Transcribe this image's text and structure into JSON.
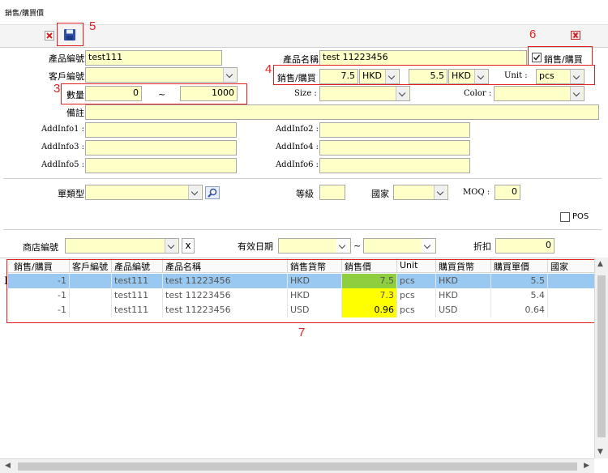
{
  "window": {
    "title": "銷售/購買價"
  },
  "annotations": {
    "n3": "3",
    "n4": "4",
    "n5": "5",
    "n6": "6",
    "n7": "7"
  },
  "form": {
    "product_code_label": "產品編號",
    "product_code_value": "test111",
    "product_name_label": "產品名稱",
    "product_name_value": "test 11223456",
    "sale_purchase_check_label": "銷售/購買",
    "sale_purchase_checked": true,
    "customer_code_label": "客戶編號",
    "customer_code_value": "",
    "price_label": "銷售/購買",
    "sale_price": "7.5",
    "sale_currency": "HKD",
    "purchase_price": "5.5",
    "purchase_currency": "HKD",
    "unit_label": "Unit :",
    "unit_value": "pcs",
    "qty_label": "數量",
    "qty_from": "0",
    "qty_tilde": "~",
    "qty_to": "1000",
    "size_label": "Size :",
    "size_value": "",
    "color_label": "Color :",
    "color_value": "",
    "remark_label": "備註",
    "remark_value": "",
    "addinfo1_label": "AddInfo1 :",
    "addinfo2_label": "AddInfo2 :",
    "addinfo3_label": "AddInfo3 :",
    "addinfo4_label": "AddInfo4 :",
    "addinfo5_label": "AddInfo5 :",
    "addinfo6_label": "AddInfo6 :"
  },
  "filters": {
    "doc_type_label": "單類型",
    "grade_label": "等級",
    "country_label": "國家",
    "moq_label": "MOQ :",
    "moq_value": "0",
    "pos_label": "POS",
    "shop_code_label": "商店編號",
    "clear_label": "x",
    "valid_date_label": "有效日期",
    "date_tilde": "~",
    "discount_label": "折扣",
    "discount_value": "0"
  },
  "grid": {
    "columns": [
      "銷售/購買",
      "客戶編號",
      "產品編號",
      "產品名稱",
      "銷售貨幣",
      "銷售價",
      "Unit",
      "購買貨幣",
      "購買單價",
      "國家"
    ],
    "rows": [
      {
        "sp": "-1",
        "cust": "",
        "code": "test111",
        "name": "test 11223456",
        "scur": "HKD",
        "sprice": "7.5",
        "unit": "pcs",
        "pcur": "HKD",
        "pprice": "5.5",
        "country": ""
      },
      {
        "sp": "-1",
        "cust": "",
        "code": "test111",
        "name": "test 11223456",
        "scur": "HKD",
        "sprice": "7.3",
        "unit": "pcs",
        "pcur": "HKD",
        "pprice": "5.4",
        "country": ""
      },
      {
        "sp": "-1",
        "cust": "",
        "code": "test111",
        "name": "test 11223456",
        "scur": "USD",
        "sprice": "0.96",
        "unit": "pcs",
        "pcur": "USD",
        "pprice": "0.64",
        "country": ""
      }
    ]
  },
  "colors": {
    "input_bg": "#ffffc8",
    "selected_row": "#99c9f0",
    "price_highlight": "#ffff00",
    "price_green": "#8fce3f",
    "annotation_red": "#e02020"
  },
  "icons": {
    "cancel": "red-x-icon",
    "save": "floppy-disk-icon",
    "close": "close-red-icon",
    "search": "search-icon"
  }
}
